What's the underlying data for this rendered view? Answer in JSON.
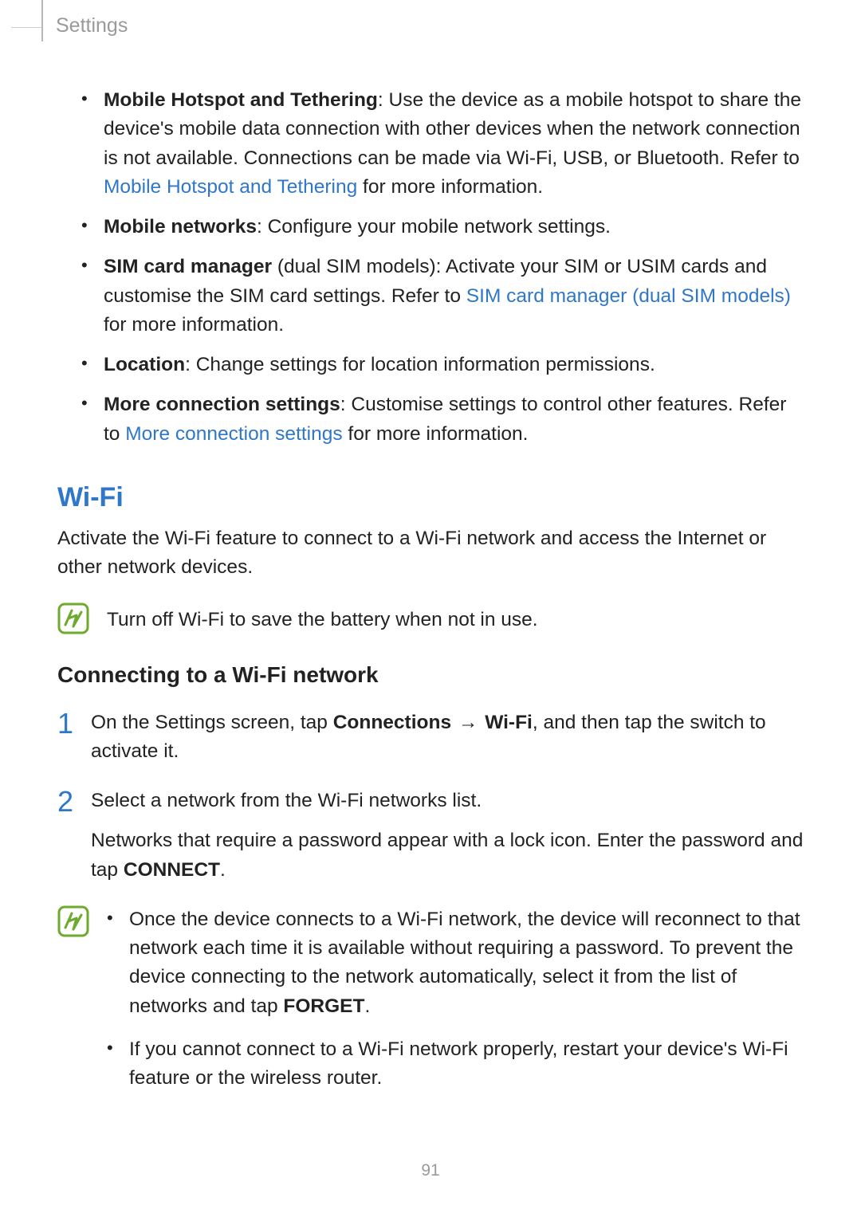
{
  "header": {
    "label": "Settings"
  },
  "intro_bullets": [
    {
      "bold": "Mobile Hotspot and Tethering",
      "rest_before_link": ": Use the device as a mobile hotspot to share the device's mobile data connection with other devices when the network connection is not available. Connections can be made via Wi-Fi, USB, or Bluetooth. Refer to ",
      "link": "Mobile Hotspot and Tethering",
      "rest_after_link": " for more information."
    },
    {
      "bold": "Mobile networks",
      "rest_before_link": ": Configure your mobile network settings.",
      "link": "",
      "rest_after_link": ""
    },
    {
      "bold": "SIM card manager",
      "rest_before_link": " (dual SIM models): Activate your SIM or USIM cards and customise the SIM card settings. Refer to ",
      "link": "SIM card manager (dual SIM models)",
      "rest_after_link": " for more information."
    },
    {
      "bold": "Location",
      "rest_before_link": ": Change settings for location information permissions.",
      "link": "",
      "rest_after_link": ""
    },
    {
      "bold": "More connection settings",
      "rest_before_link": ": Customise settings to control other features. Refer to ",
      "link": "More connection settings",
      "rest_after_link": " for more information."
    }
  ],
  "wifi": {
    "heading": "Wi-Fi",
    "intro": "Activate the Wi-Fi feature to connect to a Wi-Fi network and access the Internet or other network devices.",
    "tip": "Turn off Wi-Fi to save the battery when not in use.",
    "sub_heading": "Connecting to a Wi-Fi network",
    "steps": {
      "s1_pre": "On the Settings screen, tap ",
      "s1_b1": "Connections",
      "s1_arrow": " → ",
      "s1_b2": "Wi-Fi",
      "s1_post": ", and then tap the switch to activate it.",
      "s2_line1": "Select a network from the Wi-Fi networks list.",
      "s2_line2_pre": "Networks that require a password appear with a lock icon. Enter the password and tap ",
      "s2_line2_b": "CONNECT",
      "s2_line2_post": "."
    },
    "note_bullets": {
      "n1_pre": "Once the device connects to a Wi-Fi network, the device will reconnect to that network each time it is available without requiring a password. To prevent the device connecting to the network automatically, select it from the list of networks and tap ",
      "n1_b": "FORGET",
      "n1_post": ".",
      "n2": "If you cannot connect to a Wi-Fi network properly, restart your device's Wi-Fi feature or the wireless router."
    }
  },
  "page_number": "91",
  "icons": {
    "note": "note-icon"
  }
}
